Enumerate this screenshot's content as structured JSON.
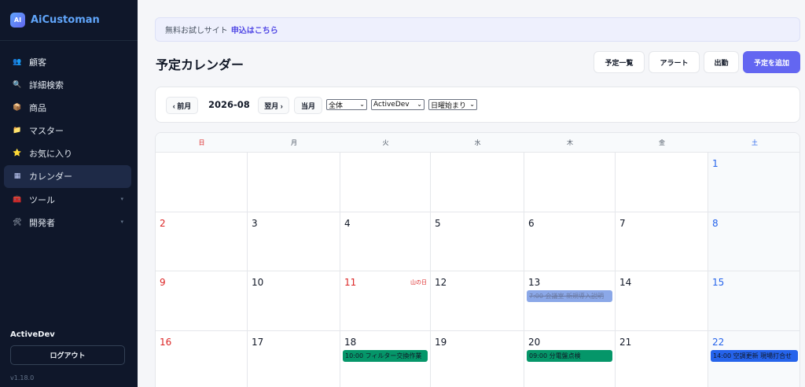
{
  "app": {
    "logo": "AI",
    "name": "AiCustoman"
  },
  "sidebar": {
    "items": [
      {
        "label": "顧客",
        "icon": "users-icon"
      },
      {
        "label": "詳細検索",
        "icon": "search-icon"
      },
      {
        "label": "商品",
        "icon": "box-icon"
      },
      {
        "label": "マスター",
        "icon": "folder-icon"
      },
      {
        "label": "お気に入り",
        "icon": "star-icon"
      },
      {
        "label": "カレンダー",
        "icon": "calendar-icon",
        "active": true
      },
      {
        "label": "ツール",
        "icon": "toolbox-icon",
        "expandable": true
      },
      {
        "label": "開発者",
        "icon": "wrench-icon",
        "expandable": true
      }
    ],
    "user": "ActiveDev",
    "logout_label": "ログアウト",
    "version": "v1.18.0"
  },
  "banner": {
    "text": "無料お試しサイト",
    "link": "申込はこちら"
  },
  "page": {
    "title": "予定カレンダー",
    "buttons": {
      "list": "予定一覧",
      "alert": "アラート",
      "clock_in": "出勤",
      "add": "予定を追加"
    }
  },
  "toolbar": {
    "prev_label": "‹ 前月",
    "month": "2026-08",
    "next_label": "翌月 ›",
    "today_label": "当月",
    "filter_scope": "全体",
    "filter_user": "ActiveDev",
    "week_start": "日曜始まり"
  },
  "calendar": {
    "weekdays": [
      "日",
      "月",
      "火",
      "水",
      "木",
      "金",
      "土"
    ],
    "weeks": [
      [
        "",
        "",
        "",
        "",
        "",
        "",
        "1"
      ],
      [
        "2",
        "3",
        "4",
        "5",
        "6",
        "7",
        "8"
      ],
      [
        "9",
        "10",
        "11",
        "12",
        "13",
        "14",
        "15"
      ],
      [
        "16",
        "17",
        "18",
        "19",
        "20",
        "21",
        "22"
      ]
    ],
    "holidays": [
      {
        "day": "11",
        "name": "山の日"
      }
    ],
    "events": [
      {
        "day": "13",
        "text": "7:00 会議室 新規導入説明",
        "style": "faded"
      },
      {
        "day": "18",
        "text": "10:00 フィルター交換作業",
        "style": "green"
      },
      {
        "day": "20",
        "text": "09:00 分電盤点検",
        "style": "green"
      },
      {
        "day": "22",
        "text": "14:00 空調更新 現場打合せ",
        "style": "blue"
      }
    ],
    "colors": {
      "sunday": "#dc2626",
      "saturday": "#2563eb",
      "accent": "#6366f1"
    }
  }
}
